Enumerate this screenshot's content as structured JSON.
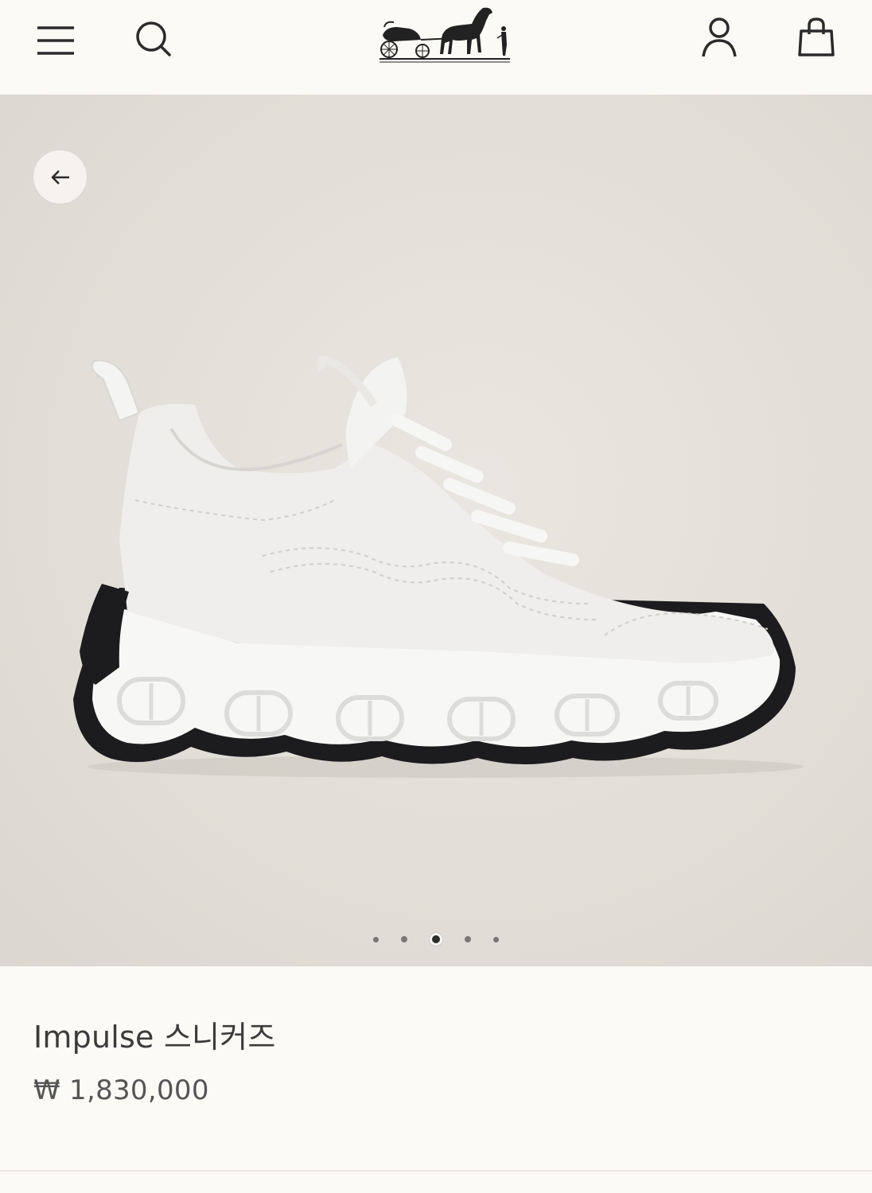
{
  "header": {
    "menu_icon": "hamburger-menu-icon",
    "search_icon": "search-icon",
    "logo": "hermes-carriage-logo",
    "account_icon": "account-icon",
    "bag_icon": "shopping-bag-icon"
  },
  "gallery": {
    "back_icon": "arrow-left-icon",
    "image": "white-sneaker-photo",
    "slide_count": 5,
    "active_slide": 3
  },
  "product": {
    "title": "Impulse 스니커즈",
    "price": "₩ 1,830,000"
  },
  "colors": {
    "background": "#fcfaf5",
    "gallery_bg": "#e2ded7",
    "text": "#3b3b3b"
  }
}
